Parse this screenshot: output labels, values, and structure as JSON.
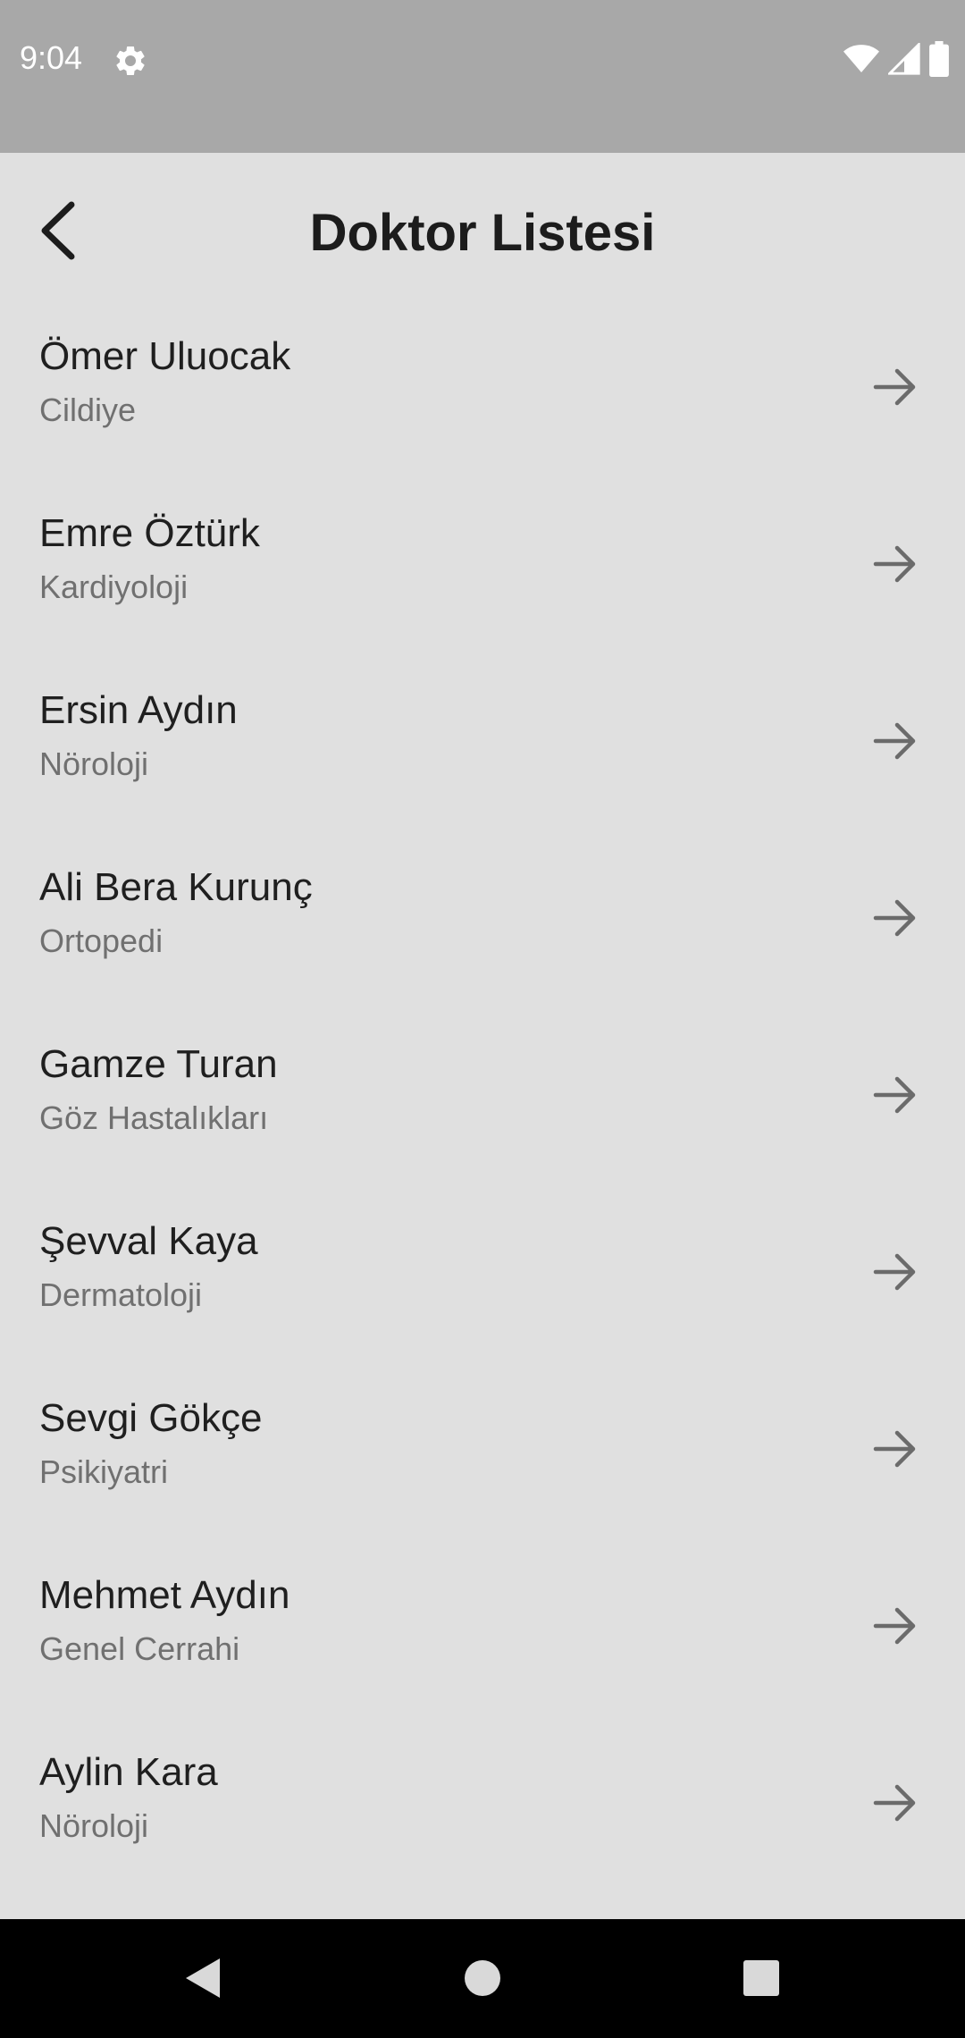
{
  "status_bar": {
    "time": "9:04",
    "icons": [
      "gear-icon",
      "wifi-icon",
      "signal-icon",
      "battery-icon"
    ]
  },
  "header": {
    "title": "Doktor Listesi",
    "back_icon": "chevron-left-icon"
  },
  "doctors": [
    {
      "name": "Ömer Uluocak",
      "specialty": "Cildiye"
    },
    {
      "name": "Emre Öztürk",
      "specialty": "Kardiyoloji"
    },
    {
      "name": "Ersin Aydın",
      "specialty": "Nöroloji"
    },
    {
      "name": "Ali Bera Kurunç",
      "specialty": "Ortopedi"
    },
    {
      "name": "Gamze Turan",
      "specialty": "Göz Hastalıkları"
    },
    {
      "name": "Şevval Kaya",
      "specialty": "Dermatoloji"
    },
    {
      "name": "Sevgi Gökçe",
      "specialty": "Psikiyatri"
    },
    {
      "name": "Mehmet Aydın",
      "specialty": "Genel Cerrahi"
    },
    {
      "name": "Aylin Kara",
      "specialty": "Nöroloji"
    }
  ],
  "item_icon": "arrow-right-icon",
  "nav_bar": {
    "icons": [
      "back-triangle-icon",
      "home-circle-icon",
      "recents-square-icon"
    ]
  },
  "colors": {
    "status_bar": "#a8a8a8",
    "background": "#e0e0e0",
    "title": "#1c1c1c",
    "subtitle": "#707070",
    "arrow": "#6b6b6b",
    "nav_bar": "#000000"
  }
}
